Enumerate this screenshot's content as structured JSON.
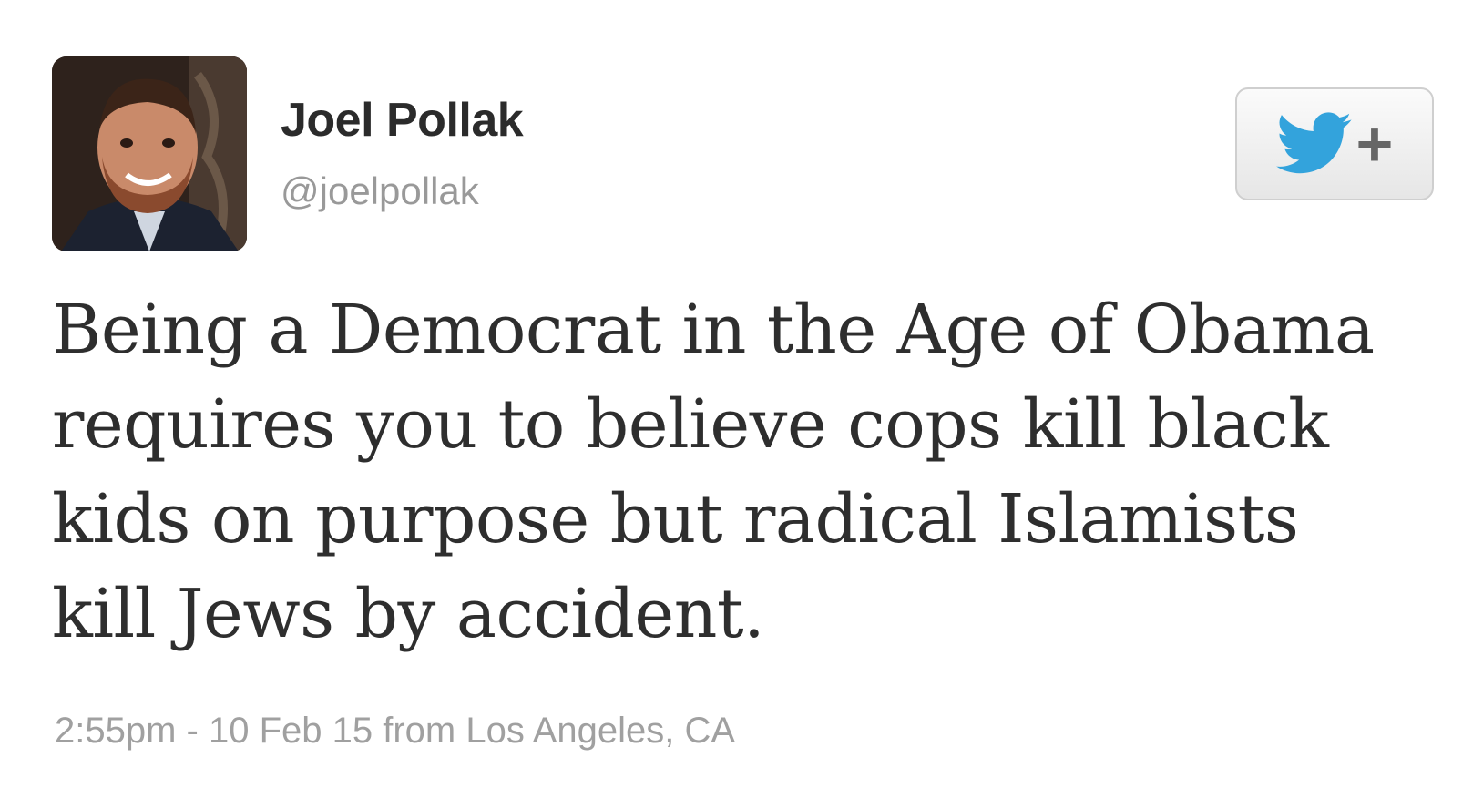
{
  "author": {
    "name": "Joel Pollak",
    "handle": "@joelpollak",
    "avatar_icon": "profile-photo"
  },
  "follow_button": {
    "icon": "twitter-bird-icon",
    "plus": "+",
    "accent_color": "#33a3dc"
  },
  "tweet": {
    "text": "Being a Democrat in the Age of Obama requires you to believe cops kill black kids on purpose but radical Islamists kill Jews by accident.",
    "timestamp": "2:55pm - 10 Feb 15 from Los Angeles, CA"
  }
}
